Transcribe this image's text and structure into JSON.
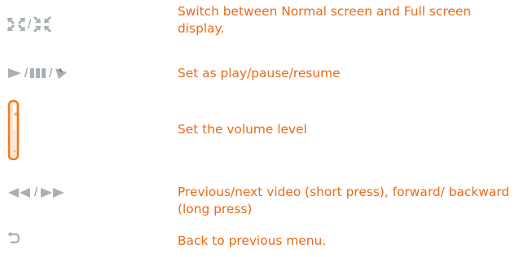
{
  "rows": [
    {
      "icons": [
        "shrink-screen-icon",
        "expand-screen-icon"
      ],
      "separators": [
        "/"
      ],
      "description": "Switch between Normal screen and Full screen display."
    },
    {
      "icons": [
        "play-icon",
        "pause-icon",
        "resume-icon"
      ],
      "separators": [
        "/",
        "/"
      ],
      "description": "Set as play/pause/resume"
    },
    {
      "icons": [
        "volume-slider-icon"
      ],
      "separators": [],
      "description": "Set the volume level"
    },
    {
      "icons": [
        "rewind-icon",
        "fast-forward-icon"
      ],
      "separators": [
        "/"
      ],
      "description": "Previous/next video (short press), forward/ backward (long press)"
    },
    {
      "icons": [
        "back-icon"
      ],
      "separators": [],
      "description": "Back to previous menu."
    }
  ],
  "colors": {
    "text": "#ea6a16",
    "icon_gray": "#9aa2a6",
    "volume_orange": "#ef7a1f"
  }
}
